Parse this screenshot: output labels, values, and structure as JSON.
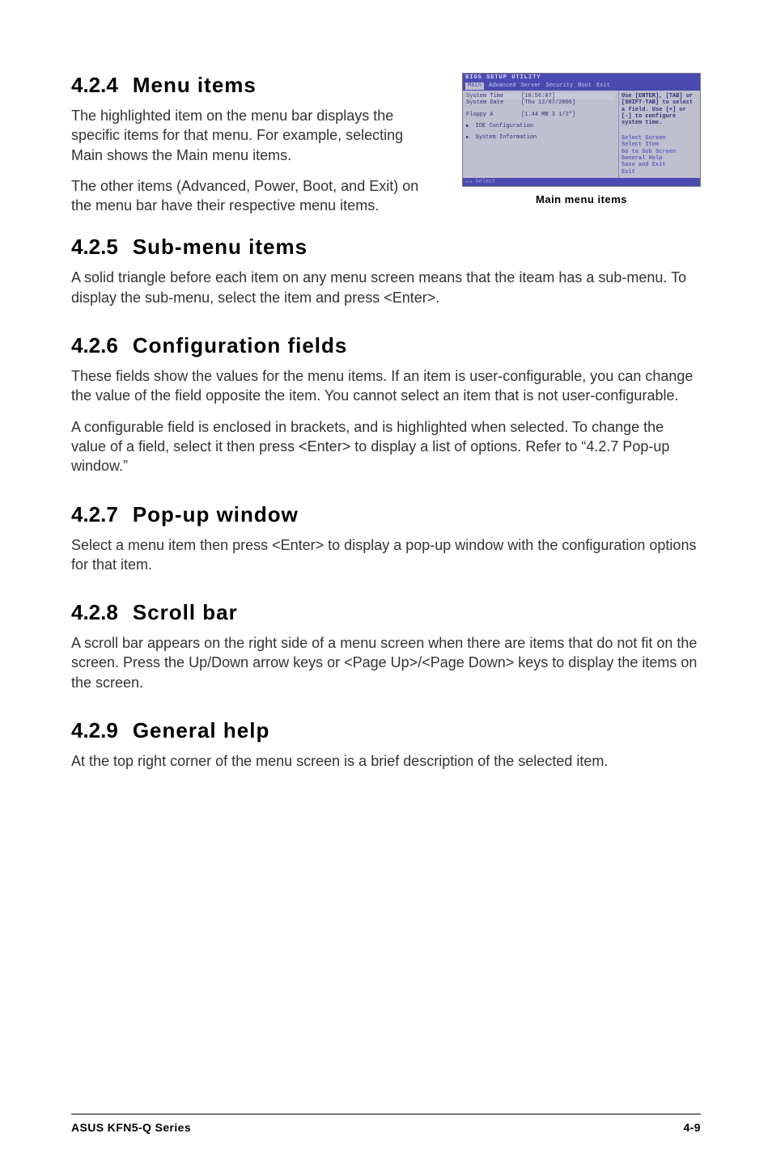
{
  "sections": {
    "s424": {
      "num": "4.2.4",
      "title": "Menu items",
      "p1": "The highlighted item on the menu bar displays the specific items for that menu. For example, selecting Main shows the Main menu items.",
      "p2": "The other items (Advanced, Power, Boot, and Exit) on the menu bar have their respective menu items."
    },
    "s425": {
      "num": "4.2.5",
      "title": "Sub-menu items",
      "p1": "A solid triangle before each item on any menu screen means that the iteam has a sub-menu. To display the sub-menu, select the item and press <Enter>."
    },
    "s426": {
      "num": "4.2.6",
      "title": "Configuration fields",
      "p1": "These fields show the values for the menu items. If an item is user-configurable, you can change the value of the field opposite the item. You cannot select an item that is not user-configurable.",
      "p2": "A configurable field is enclosed in brackets, and is highlighted when selected. To change the value of a field, select it then press <Enter> to display a list of options. Refer to “4.2.7 Pop-up window.”"
    },
    "s427": {
      "num": "4.2.7",
      "title": "Pop-up window",
      "p1": "Select a menu item then press <Enter> to display a pop-up window with the configuration options for that item."
    },
    "s428": {
      "num": "4.2.8",
      "title": "Scroll bar",
      "p1": "A scroll bar appears on the right side of a menu screen when there are items that do not fit on the screen. Press the Up/Down arrow keys or <Page Up>/<Page Down> keys to display the items on the screen."
    },
    "s429": {
      "num": "4.2.9",
      "title": "General help",
      "p1": "At the top right corner of the menu screen is a brief description of the selected item."
    }
  },
  "bios": {
    "title": "BIOS SETUP UTILITY",
    "tabs": [
      "Main",
      "Advanced",
      "Server",
      "Security",
      "Boot",
      "Exit"
    ],
    "rows": {
      "time": {
        "label": "System Time",
        "value": "[10:56:07]"
      },
      "date": {
        "label": "System Date",
        "value": "[Thu 12/07/2006]"
      },
      "floppy": {
        "label": "Floppy A",
        "value": "[1.44 MB 3 1/2\"]"
      },
      "ide": {
        "label": "IDE Configuration"
      },
      "sysinfo": {
        "label": "System Information"
      }
    },
    "help": "Use [ENTER], [TAB] or [SHIFT-TAB] to select a field. Use [+] or [-] to configure system time.",
    "nav_left": "←→",
    "nav_left_text": "Select",
    "nav_hints": {
      "a": "Select Screen",
      "b": "Select Item",
      "c": "Go to Sub Screen",
      "d": "General Help",
      "e": "Save and Exit",
      "f": "Exit"
    },
    "caption": "Main menu items"
  },
  "footer": {
    "left": "ASUS KFN5-Q Series",
    "right": "4-9"
  }
}
